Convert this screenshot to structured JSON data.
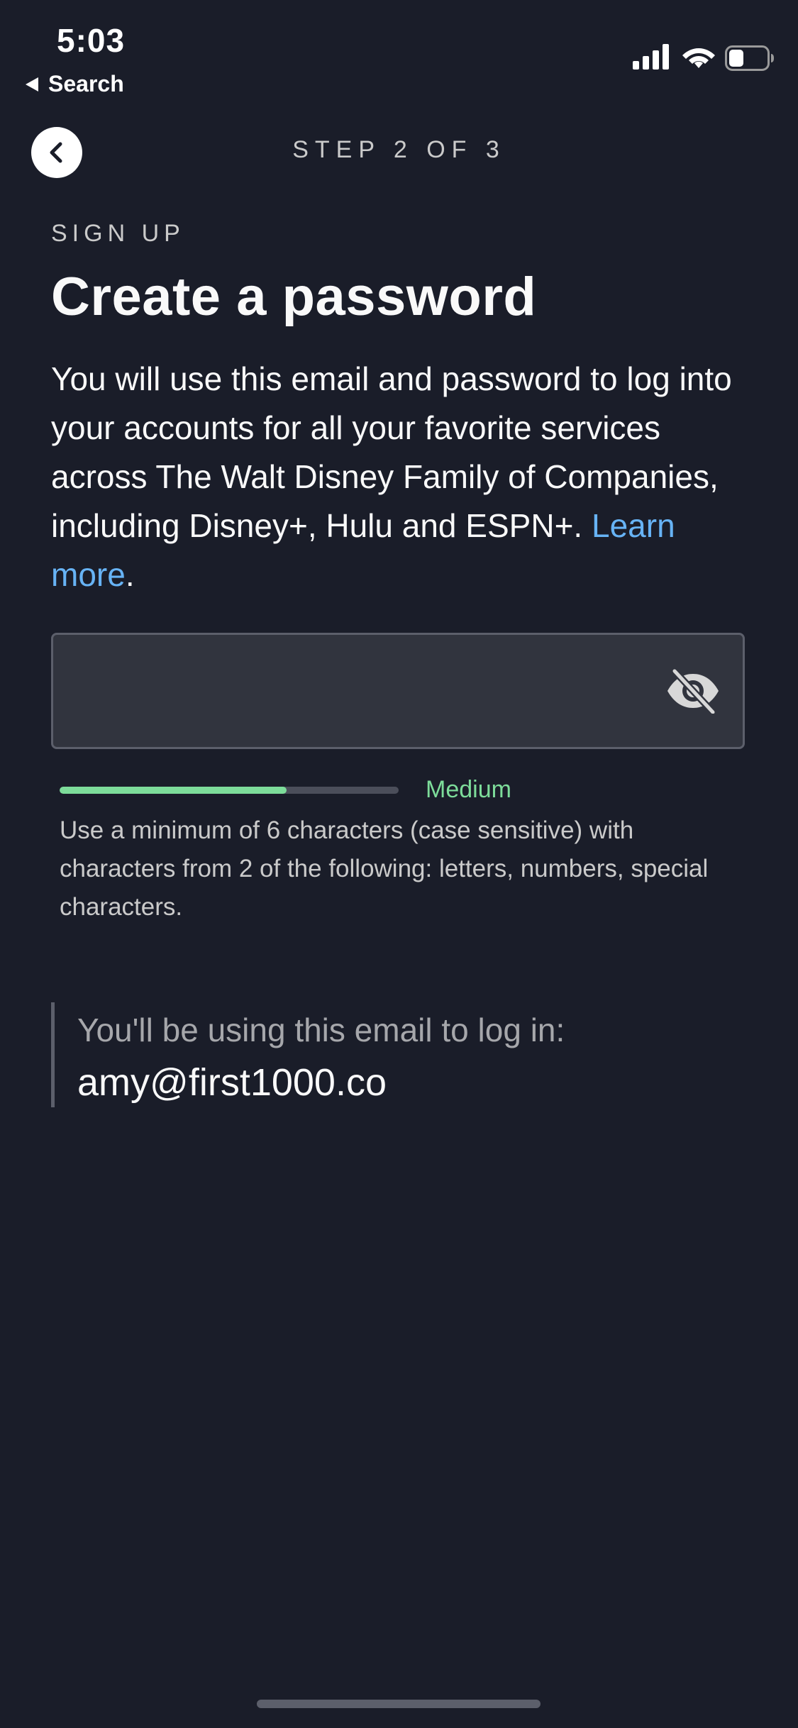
{
  "status_bar": {
    "time": "5:03",
    "back_app": "Search",
    "battery_level": 0.4
  },
  "header": {
    "step": "STEP 2 OF 3"
  },
  "content": {
    "eyebrow": "SIGN UP",
    "title": "Create a password",
    "description": "You will use this email and password to log into your accounts for all your favorite services across The Walt Disney Family of Companies, including Disney+, Hulu and ESPN+.",
    "learn_more": "Learn more",
    "learn_more_suffix": "."
  },
  "password_field": {
    "value": "",
    "placeholder": "",
    "toggle_icon": "eye-off-icon"
  },
  "strength": {
    "level": 0.67,
    "label": "Medium",
    "hint": "Use a minimum of 6 characters (case sensitive) with characters from 2 of the following: letters, numbers, special characters."
  },
  "email_info": {
    "caption": "You'll be using this email to log in:",
    "email": "amy@first1000.co"
  },
  "colors": {
    "background": "#1a1d29",
    "accent_link": "#67b3f5",
    "strength_medium": "#7ddc9a",
    "input_bg": "#31343e"
  }
}
